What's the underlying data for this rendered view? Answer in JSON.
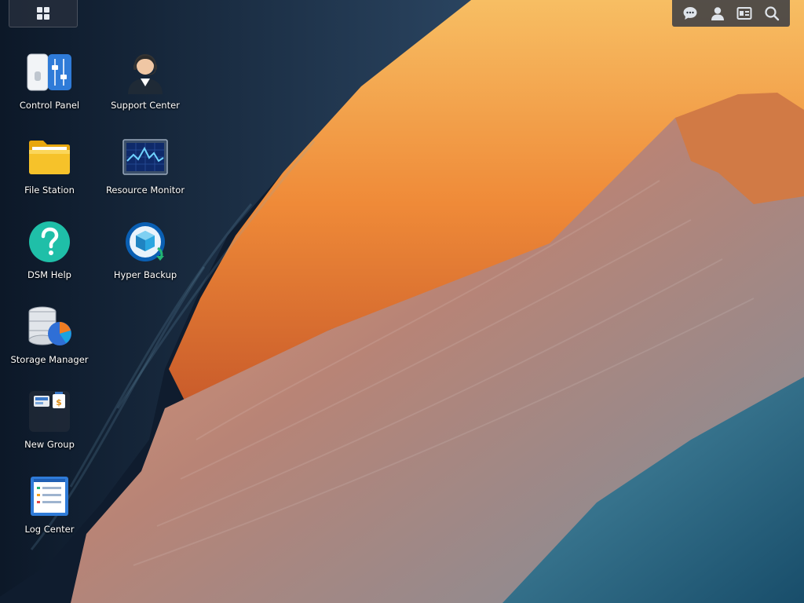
{
  "desktop": {
    "icons": [
      {
        "label": "Control Panel",
        "icon": "control-panel-icon"
      },
      {
        "label": "Support Center",
        "icon": "support-center-icon"
      },
      {
        "label": "File Station",
        "icon": "folder-icon"
      },
      {
        "label": "Resource Monitor",
        "icon": "resource-monitor-icon"
      },
      {
        "label": "DSM Help",
        "icon": "help-icon"
      },
      {
        "label": "Hyper Backup",
        "icon": "backup-icon"
      },
      {
        "label": "Storage Manager",
        "icon": "storage-manager-icon"
      },
      {
        "label": "New Group",
        "icon": "app-group-icon"
      },
      {
        "label": "Log Center",
        "icon": "log-center-icon"
      }
    ]
  },
  "taskbar": {
    "tray_icons": [
      "chat-icon",
      "user-icon",
      "widgets-icon",
      "search-icon"
    ]
  },
  "colors": {
    "tray_bg": "#30363f",
    "accent_blue": "#2f7bd8",
    "help_teal": "#1fbfa8"
  }
}
